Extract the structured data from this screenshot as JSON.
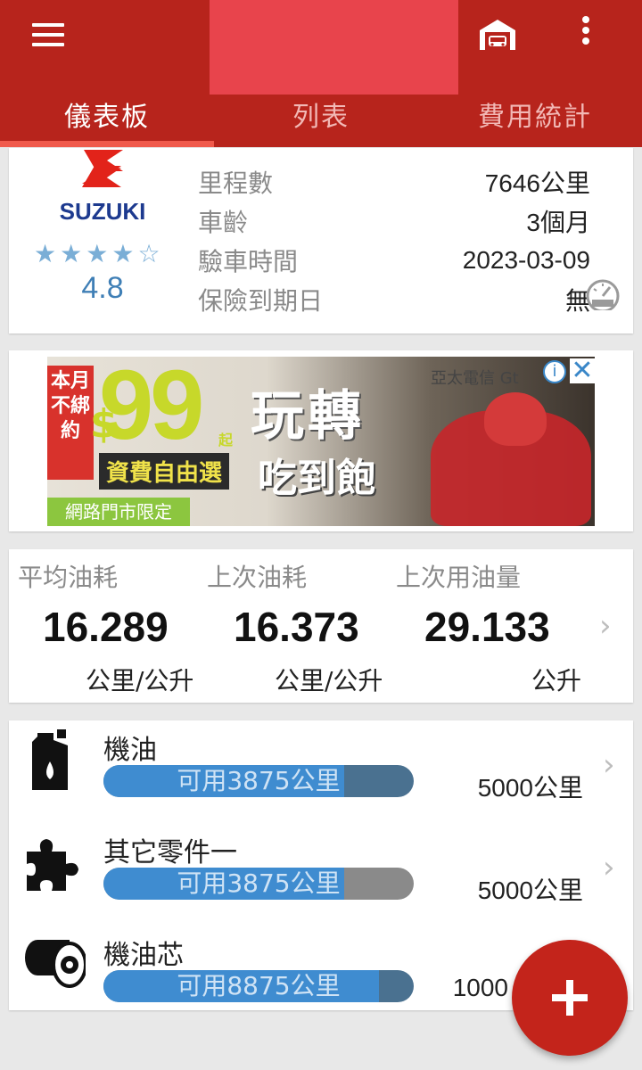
{
  "appbar": {
    "menu_icon": "hamburger-menu-icon",
    "garage_icon": "garage-icon",
    "more_icon": "more-vert-icon",
    "colors": {
      "primary": "#b7241c",
      "accent": "#f05a4c"
    }
  },
  "tabs": [
    {
      "label": "儀表板",
      "active": true
    },
    {
      "label": "列表",
      "active": false
    },
    {
      "label": "費用統計",
      "active": false
    }
  ],
  "vehicle": {
    "brand": "SUZUKI",
    "stars": [
      "★",
      "★",
      "★",
      "★",
      "☆"
    ],
    "rating": "4.8",
    "info": [
      {
        "label": "里程數",
        "value": "7646公里"
      },
      {
        "label": "車齡",
        "value": "3個月"
      },
      {
        "label": "驗車時間",
        "value": "2023-03-09"
      },
      {
        "label": "保險到期日",
        "value": "無"
      }
    ]
  },
  "ad": {
    "side_text": "本月 不綁約",
    "dollar": "$",
    "price": "99",
    "price_suffix": "起",
    "sub": "資費自由選",
    "foot": "網路門市限定",
    "headline": "玩轉",
    "headline2": "吃到飽",
    "brand": "亞太電信 Gt",
    "info": "i",
    "close": "✕"
  },
  "fuel": {
    "columns": [
      {
        "label": "平均油耗",
        "value": "16.289",
        "unit": "公里/公升"
      },
      {
        "label": "上次油耗",
        "value": "16.373",
        "unit": "公里/公升"
      },
      {
        "label": "上次用油量",
        "value": "29.133",
        "unit": "公升"
      }
    ],
    "chevron": "›"
  },
  "maintenance": [
    {
      "name": "機油",
      "remaining": "可用3875公里",
      "total": "5000公里",
      "progress": 0.775,
      "icon": "oil-bottle-icon"
    },
    {
      "name": "其它零件一",
      "remaining": "可用3875公里",
      "total": "5000公里",
      "progress": 0.775,
      "icon": "puzzle-piece-icon"
    },
    {
      "name": "機油芯",
      "remaining": "可用8875公里",
      "total": "1000",
      "progress": 0.8875,
      "icon": "oil-filter-icon"
    }
  ],
  "fab": {
    "icon": "plus-icon"
  }
}
